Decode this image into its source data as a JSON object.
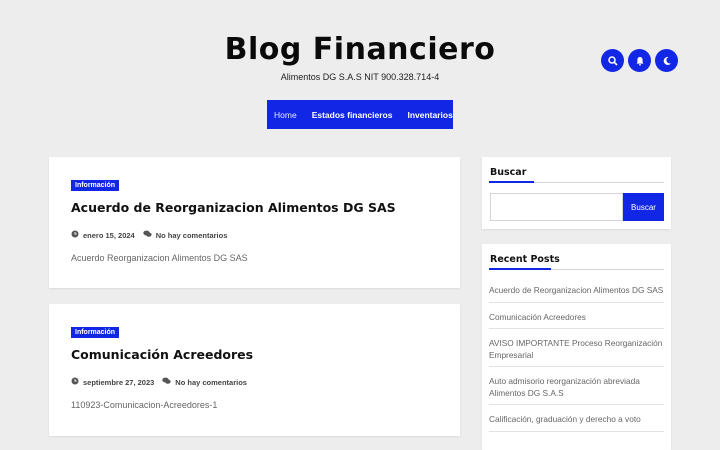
{
  "header": {
    "title": "Blog Financiero",
    "description": "Alimentos DG S.A.S NIT 900.328.714-4",
    "icons": [
      "search-icon",
      "bell-icon",
      "moon-icon"
    ]
  },
  "nav": {
    "items": [
      {
        "label": "Home",
        "active": true
      },
      {
        "label": "Estados financieros",
        "active": false
      },
      {
        "label": "Inventarios",
        "active": false
      }
    ]
  },
  "posts": [
    {
      "category": "Información",
      "title": "Acuerdo de Reorganizacion Alimentos DG SAS",
      "date": "enero 15, 2024",
      "comments": "No hay comentarios",
      "excerpt": "Acuerdo Reorganizacion Alimentos DG SAS"
    },
    {
      "category": "Información",
      "title": "Comunicación Acreedores",
      "date": "septiembre 27, 2023",
      "comments": "No hay comentarios",
      "excerpt": "110923-Comunicacion-Acreedores-1"
    }
  ],
  "sidebar": {
    "search": {
      "title": "Buscar",
      "placeholder": "",
      "button_label": "Buscar"
    },
    "recent": {
      "title": "Recent Posts",
      "items": [
        "Acuerdo de Reorganizacion Alimentos DG SAS",
        "Comunicación Acreedores",
        "AVISO IMPORTANTE Proceso Reorganización Empresarial",
        "Auto admisorio reorganización abreviada Alimentos DG S.A.S",
        "Calificación, graduación y derecho a voto"
      ]
    }
  },
  "colors": {
    "accent": "#1227e6",
    "background": "#ededed"
  }
}
